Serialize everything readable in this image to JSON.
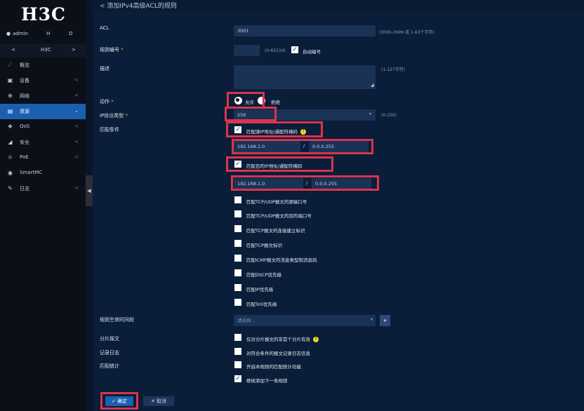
{
  "app": {
    "logo": "H3C"
  },
  "user": {
    "name": "admin",
    "icon_a": "H",
    "icon_b": "D"
  },
  "nav": {
    "prev": "<",
    "label": "H3C",
    "next": ">"
  },
  "menu": [
    {
      "label": "概览",
      "icon": "dashboard-icon"
    },
    {
      "label": "设备",
      "icon": "device-icon"
    },
    {
      "label": "网络",
      "icon": "network-icon"
    },
    {
      "label": "资源",
      "icon": "resource-icon",
      "active": true
    },
    {
      "label": "QoS",
      "icon": "qos-icon"
    },
    {
      "label": "安全",
      "icon": "security-icon"
    },
    {
      "label": "PoE",
      "icon": "poe-icon"
    },
    {
      "label": "SmartMC",
      "icon": "smartmc-icon"
    },
    {
      "label": "日志",
      "icon": "log-icon"
    }
  ],
  "page": {
    "back": "<",
    "title": "添加IPv4高级ACL的规则"
  },
  "form": {
    "acl": {
      "label": "ACL",
      "value": "3001",
      "hint": "(3000-3999 或 1-63个字符)"
    },
    "rule_id": {
      "label": "规则编号",
      "value": "",
      "hint": "(0-65534)",
      "auto_label": "自动编号"
    },
    "desc": {
      "label": "描述",
      "value": "",
      "hint": "(1-127字符)"
    },
    "action": {
      "label": "动作",
      "permit": "允许",
      "deny": "拒绝"
    },
    "protocol": {
      "label": "IP协议类型",
      "value": "256",
      "hint": "(0-256)"
    },
    "match": {
      "label": "匹配条件"
    },
    "src": {
      "label": "匹配源IP地址/通配符掩码",
      "ip": "192.168.2.0",
      "sep": "/",
      "mask": "0.0.0.255"
    },
    "dst": {
      "label": "匹配目的IP地址/通配符掩码",
      "ip": "192.168.1.0",
      "sep": "/",
      "mask": "0.0.0.255"
    },
    "options": [
      "匹配TCP/UDP报文的源端口号",
      "匹配TCP/UDP报文的目的端口号",
      "匹配TCP报文的连接建立标识",
      "匹配TCP报文标识",
      "匹配ICMP报文的消息类型和消息码",
      "匹配DSCP优先级",
      "匹配IP优先级",
      "匹配ToS优先级"
    ],
    "time_range": {
      "label": "规则生效时间段",
      "placeholder": "请选择...",
      "add": "+"
    },
    "fragment": {
      "label": "分片报文",
      "text": "仅对分片报文的非首个分片有效"
    },
    "logging": {
      "label": "记录日志",
      "text": "对符合条件的报文记录日志信息"
    },
    "counting": {
      "label": "匹配统计",
      "text": "开启本规则的匹配统计功能"
    },
    "continue": {
      "text": "继续添加下一条规则"
    }
  },
  "buttons": {
    "ok": "确定",
    "cancel": "取消"
  },
  "colors": {
    "accent": "#1b5fb0",
    "highlight": "#d9344d",
    "bg": "#0a1d39",
    "input": "#1b3257"
  }
}
